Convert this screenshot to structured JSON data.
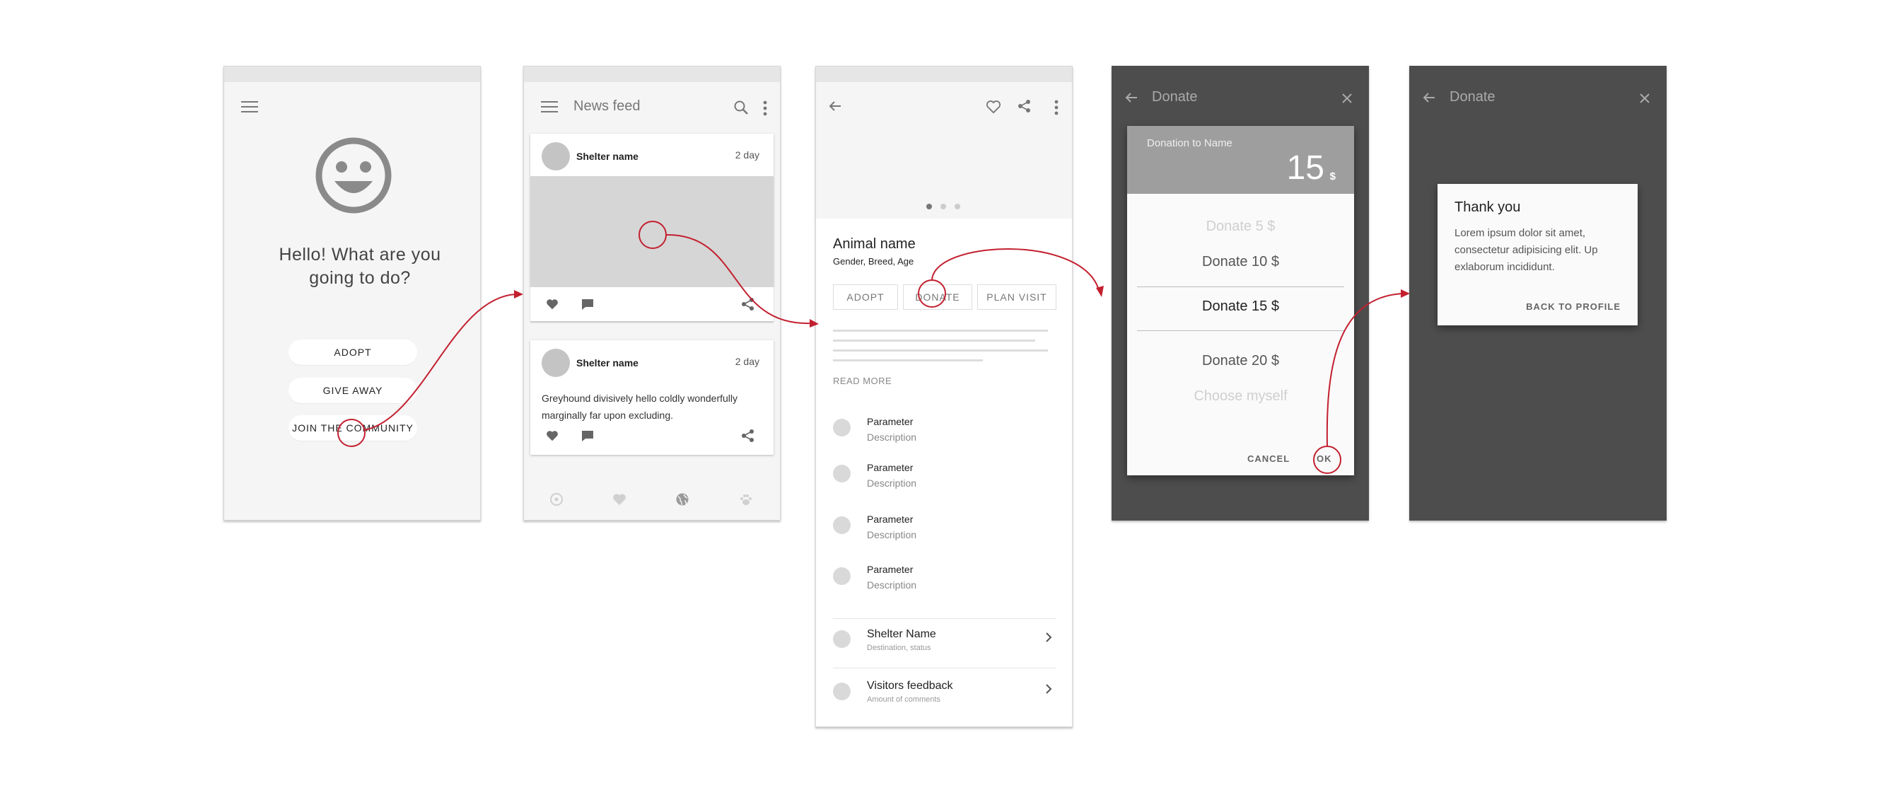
{
  "colors": {
    "accent": "#c3202f",
    "gray_bg": "#f5f5f5",
    "dark_bg": "#4d4d4d",
    "header_gray": "#9e9e9e"
  },
  "screen1": {
    "icons": [
      "menu-icon",
      "smiley-icon"
    ],
    "greeting": "Hello! What are you going to do?",
    "buttons": [
      "ADOPT",
      "GIVE AWAY",
      "JOIN THE COMMUNITY"
    ]
  },
  "screen2": {
    "title": "News feed",
    "icons": [
      "menu-icon",
      "search-icon",
      "more-vert-icon",
      "heart-icon",
      "comment-icon",
      "share-icon",
      "explore-icon",
      "favorite-icon",
      "globe-icon",
      "paw-icon"
    ],
    "card1": {
      "shelter": "Shelter name",
      "day": "2 day"
    },
    "card2": {
      "shelter": "Shelter name",
      "day": "2 day",
      "text": "Greyhound divisively hello coldly wonderfully marginally far upon excluding."
    }
  },
  "screen3": {
    "icons": [
      "back-arrow-icon",
      "heart-outline-icon",
      "share-icon",
      "more-vert-icon",
      "chevron-right-icon"
    ],
    "animal_name": "Animal name",
    "subtitle": "Gender, Breed, Age",
    "buttons": [
      "ADOPT",
      "DONATE",
      "PLAN VISIT"
    ],
    "read_more": "READ MORE",
    "params": [
      {
        "title": "Parameter",
        "desc": "Description"
      },
      {
        "title": "Parameter",
        "desc": "Description"
      },
      {
        "title": "Parameter",
        "desc": "Description"
      },
      {
        "title": "Parameter",
        "desc": "Description"
      }
    ],
    "links": [
      {
        "title": "Shelter Name",
        "sub": "Destination, status"
      },
      {
        "title": "Visitors feedback",
        "sub": "Amount of comments"
      }
    ]
  },
  "screen4": {
    "title": "Donate",
    "icons": [
      "back-arrow-icon",
      "close-icon"
    ],
    "dialog_header": "Donation to Name",
    "amount": "15",
    "currency": "$",
    "options": [
      "Donate 5 $",
      "Donate 10 $",
      "Donate 15 $",
      "Donate 20 $",
      "Choose myself"
    ],
    "cancel": "CANCEL",
    "ok": "OK"
  },
  "screen5": {
    "title": "Donate",
    "icons": [
      "back-arrow-icon",
      "close-icon"
    ],
    "dialog_title": "Thank you",
    "dialog_text": "Lorem ipsum dolor sit amet, consectetur adipisicing elit. Up exlaborum incididunt.",
    "back_button": "BACK TO PROFILE"
  }
}
